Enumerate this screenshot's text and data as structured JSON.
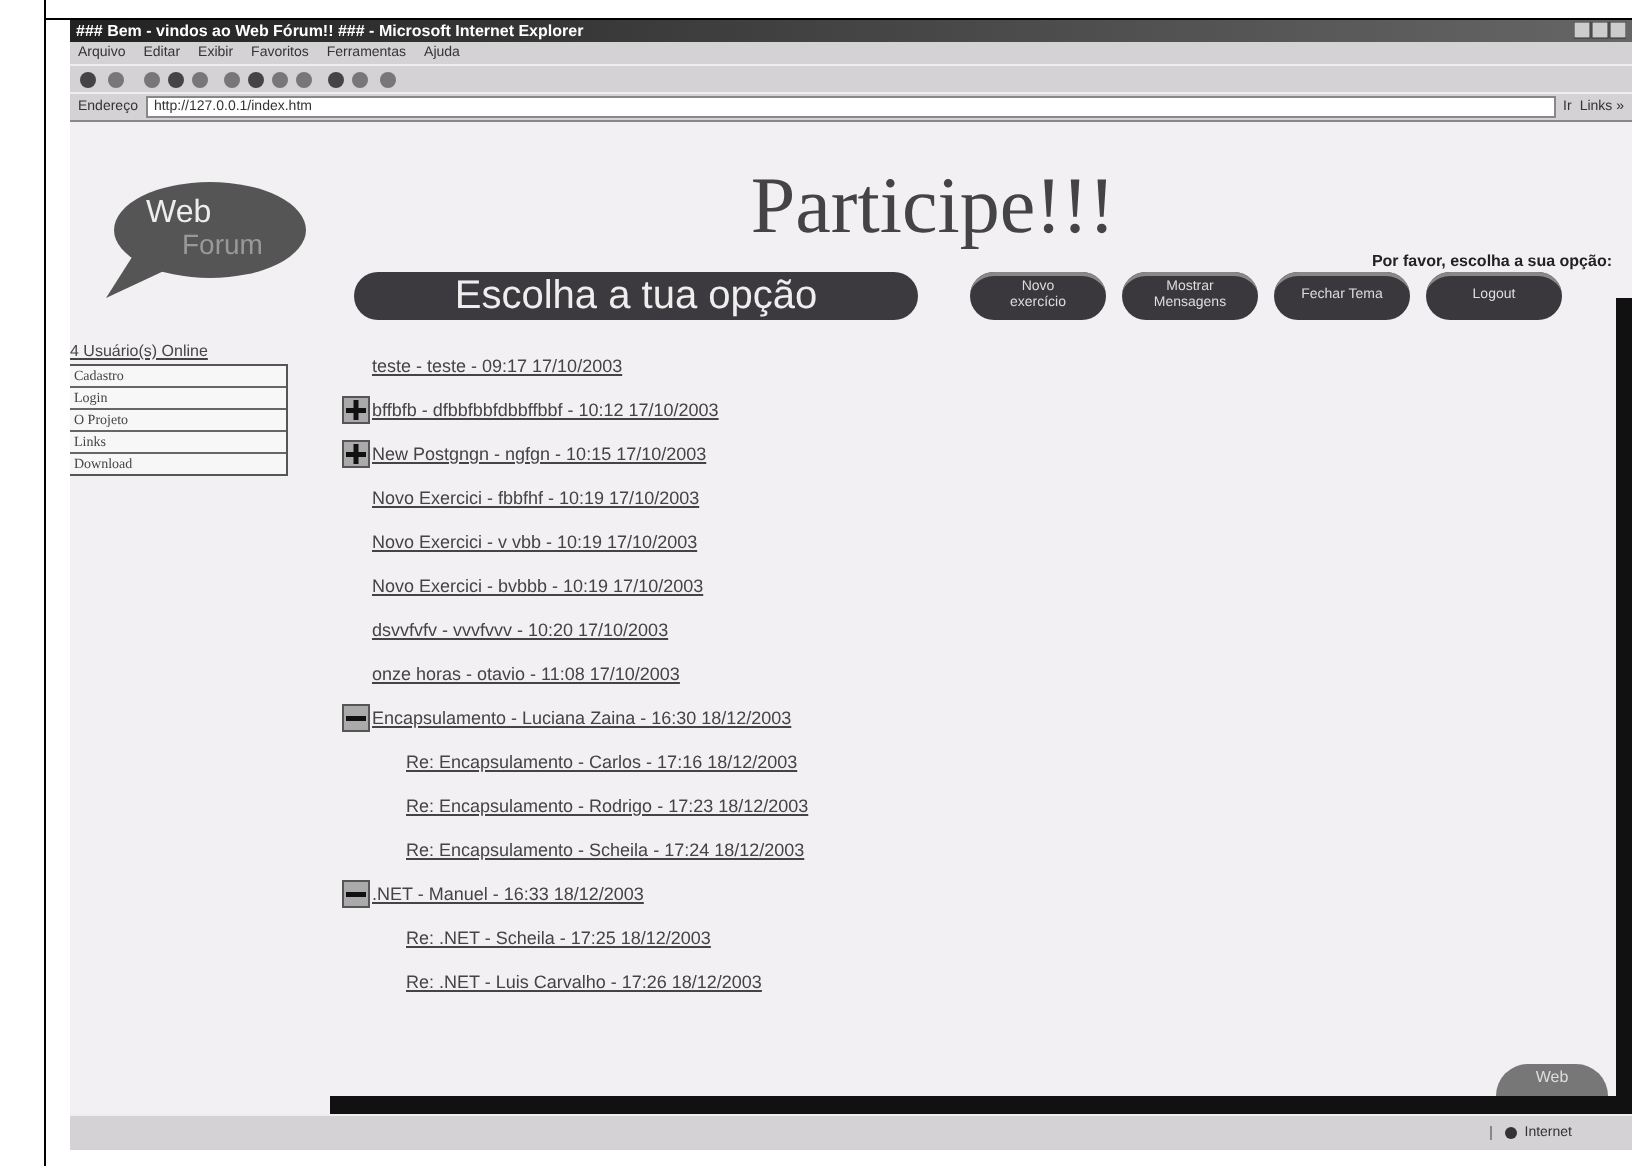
{
  "window": {
    "title": "### Bem - vindos ao Web Fórum!! ### - Microsoft Internet Explorer"
  },
  "menu": [
    "Arquivo",
    "Editar",
    "Exibir",
    "Favoritos",
    "Ferramentas",
    "Ajuda"
  ],
  "address_bar": {
    "label": "Endereço",
    "value": "http://127.0.0.1/index.htm",
    "go": "Ir",
    "links": "Links »"
  },
  "logo": {
    "line_1": "Web",
    "line_2": "Forum"
  },
  "heading": "Participe!!!",
  "prompt": "Por favor, escolha a sua opção:",
  "banner": "Escolha a tua opção",
  "buttons": [
    {
      "line_1": "Novo",
      "line_2": "exercício"
    },
    {
      "line_1": "Mostrar",
      "line_2": "Mensagens"
    },
    {
      "line_1": "Fechar Tema"
    },
    {
      "line_1": "Logout"
    }
  ],
  "sidebar": {
    "users_online": "4 Usuário(s) Online",
    "items": [
      "Cadastro",
      "Login",
      "O Projeto",
      "Links",
      "Download"
    ]
  },
  "topics": [
    {
      "label": "teste - teste - 09:17 17/10/2003"
    },
    {
      "label": "bffbfb - dfbbfbbfdbbffbbf - 10:12 17/10/2003",
      "expanded": false
    },
    {
      "label": "New Postgngn - ngfgn - 10:15 17/10/2003",
      "expanded": false
    },
    {
      "label": "Novo Exercici - fbbfhf - 10:19 17/10/2003"
    },
    {
      "label": "Novo Exercici - v vbb - 10:19 17/10/2003"
    },
    {
      "label": "Novo Exercici - bvbbb - 10:19 17/10/2003"
    },
    {
      "label": "dsvvfvfv - vvvfvvv - 10:20 17/10/2003"
    },
    {
      "label": "onze horas - otavio - 11:08 17/10/2003"
    },
    {
      "label": "Encapsulamento - Luciana Zaina - 16:30 18/12/2003",
      "expanded": true,
      "children": [
        {
          "label": "Re: Encapsulamento - Carlos - 17:16 18/12/2003"
        },
        {
          "label": "Re: Encapsulamento - Rodrigo - 17:23 18/12/2003"
        },
        {
          "label": "Re: Encapsulamento - Scheila - 17:24 18/12/2003"
        }
      ]
    },
    {
      "label": ".NET - Manuel - 16:33 18/12/2003",
      "expanded": true,
      "children": [
        {
          "label": "Re: .NET - Scheila - 17:25 18/12/2003"
        },
        {
          "label": "Re: .NET - Luis Carvalho - 17:26 18/12/2003"
        }
      ]
    }
  ],
  "corner_logo": "Web",
  "status_bar": {
    "zone": "Internet"
  }
}
